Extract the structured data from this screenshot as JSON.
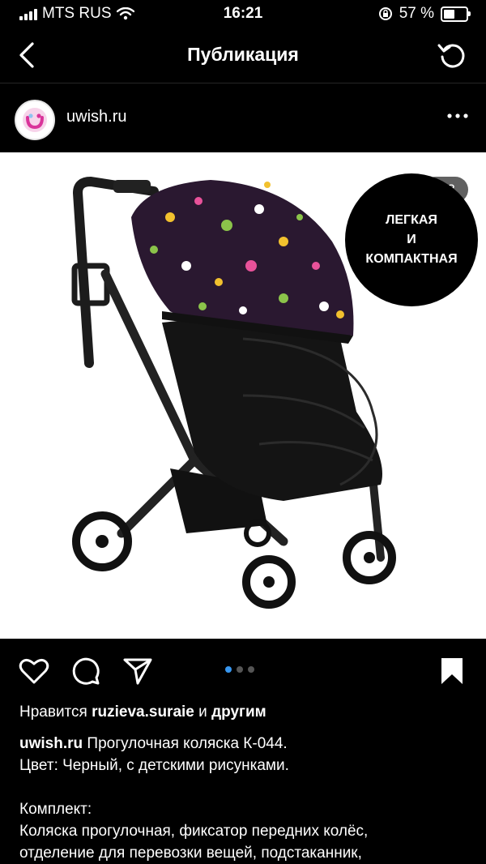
{
  "status": {
    "carrier": "MTS RUS",
    "time": "16:21",
    "battery": "57 %",
    "battery_level": 0.57,
    "icons": [
      "signal-icon",
      "wifi-icon",
      "orientation-lock-icon",
      "battery-icon"
    ]
  },
  "nav": {
    "title": "Публикация",
    "icons": [
      "back-icon",
      "refresh-icon"
    ]
  },
  "post": {
    "username": "uwish.ru",
    "image_counter": "1/3",
    "badge_lines": [
      "ЛЕГКАЯ",
      "И",
      "КОМПАКТНАЯ"
    ],
    "carousel_total": 3,
    "carousel_active": 1,
    "icons": [
      "heart-icon",
      "comment-icon",
      "share-icon",
      "bookmark-icon",
      "more-icon"
    ]
  },
  "likes": {
    "prefix": "Нравится",
    "user": "ruzieva.suraie",
    "middle": "и",
    "suffix": "другим"
  },
  "caption": {
    "author": "uwish.ru",
    "line1": "Прогулочная коляска К-044.",
    "line2": "Цвет: Черный, с детскими рисунками.",
    "line3": "Комплект:",
    "line4": "Коляска прогулочная, фиксатор передних колёс,",
    "line5": "отделение для перевозки вещей, подстаканник,"
  },
  "colors": {
    "background": "#000000",
    "accent": "#3897f0",
    "canopy": "#2a1830"
  }
}
